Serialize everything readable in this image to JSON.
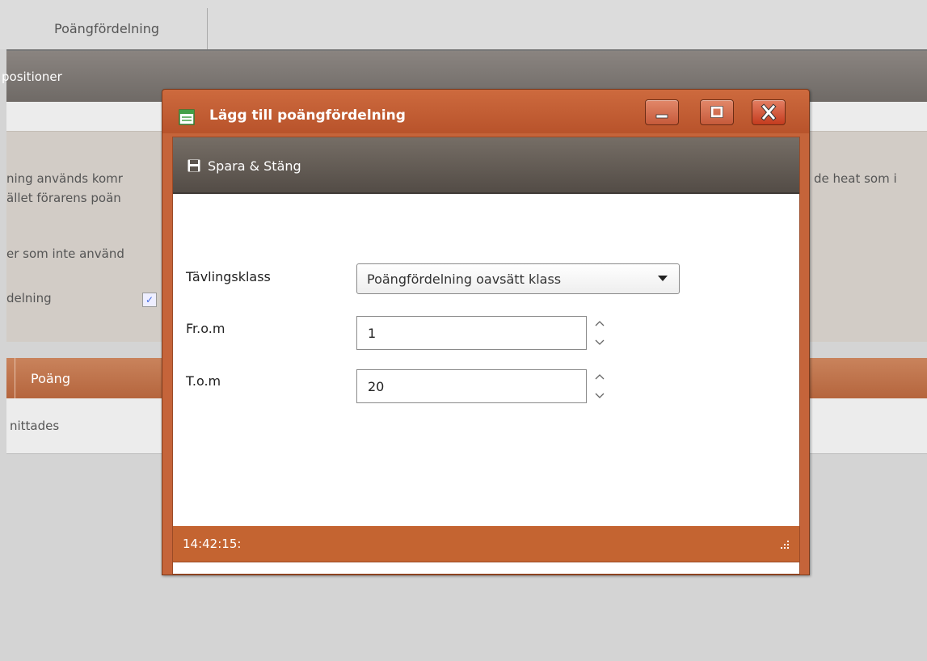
{
  "background": {
    "tab_label": "Poängfördelning",
    "header_title": "positioner",
    "text_line1": "ning används komr",
    "text_line2": "ället förarens poän",
    "text_line3": "er som inte använd",
    "text_line4": "delning",
    "text_right": "de heat som i",
    "column_header": "Poäng",
    "empty_row": "nittades",
    "checkbox_checked": true
  },
  "dialog": {
    "title": "Lägg till poängfördelning",
    "toolbar": {
      "save_label": "Spara & Stäng"
    },
    "fields": {
      "class_label": "Tävlingsklass",
      "class_value": "Poängfördelning oavsätt klass",
      "from_label": "Fr.o.m",
      "from_value": "1",
      "to_label": "T.o.m",
      "to_value": "20"
    },
    "status": "14:42:15:"
  },
  "colors": {
    "accent": "#c5643a",
    "toolbar": "#5f5751",
    "background": "#d4d4d4"
  },
  "icons": [
    "window-icon",
    "minimize-icon",
    "maximize-icon",
    "close-icon",
    "save-icon",
    "chevron-up-icon",
    "chevron-down-icon",
    "resize-grip-icon"
  ]
}
